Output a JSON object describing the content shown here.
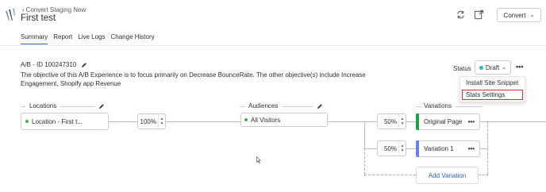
{
  "header": {
    "back_label": "Convert Staging New",
    "title": "First test",
    "convert_label": "Convert"
  },
  "tabs": [
    {
      "label": "Summary",
      "active": true
    },
    {
      "label": "Report",
      "active": false
    },
    {
      "label": "Live Logs",
      "active": false
    },
    {
      "label": "Change History",
      "active": false
    }
  ],
  "experience": {
    "id_label": "A/B - ID 100247310",
    "objective": "The objective of this A/B Experience is to focus primarily on Decrease BounceRate. The other objective(s) include Increase Engagement, Shopify app Revenue"
  },
  "status": {
    "label": "Status",
    "value": "Draft",
    "menu": [
      "Install Site Snippet",
      "Stats Settings"
    ]
  },
  "flow": {
    "locations_label": "Locations",
    "location_value": "Location - First t...",
    "traffic_percent": "100%",
    "audiences_label": "Audiences",
    "audience_value": "All Visitors",
    "variations_label": "Variations",
    "variations": [
      {
        "percent": "50%",
        "name": "Original Page",
        "color": "#2a9a4b"
      },
      {
        "percent": "50%",
        "name": "Variation 1",
        "color": "#6f7fe6"
      }
    ],
    "add_variation_label": "Add Variation"
  }
}
